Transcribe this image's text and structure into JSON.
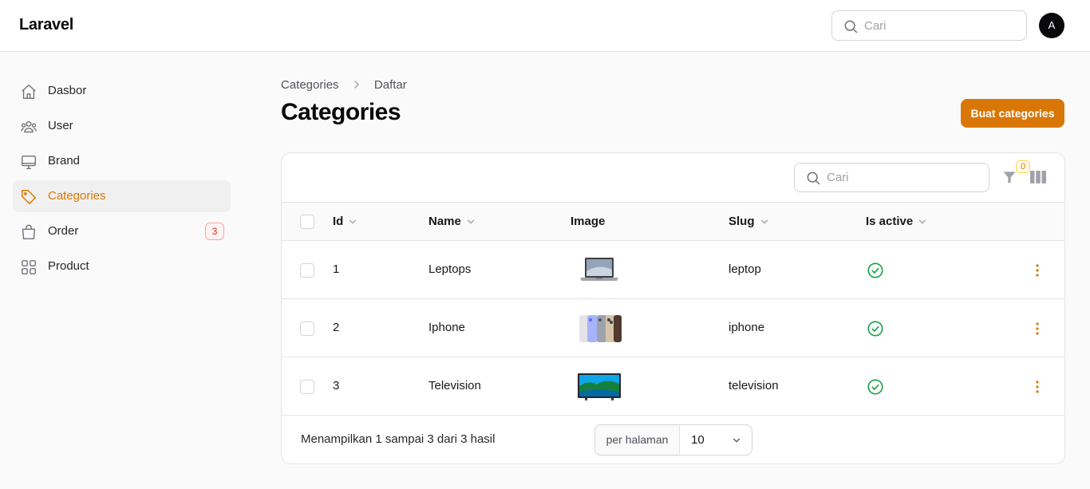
{
  "app": {
    "brand": "Laravel",
    "avatar_initial": "A",
    "search_placeholder": "Cari"
  },
  "sidebar": {
    "items": [
      {
        "label": "Dasbor",
        "icon": "home-icon",
        "active": false
      },
      {
        "label": "User",
        "icon": "users-icon",
        "active": false
      },
      {
        "label": "Brand",
        "icon": "monitor-icon",
        "active": false
      },
      {
        "label": "Categories",
        "icon": "tag-icon",
        "active": true
      },
      {
        "label": "Order",
        "icon": "shopping-bag-icon",
        "active": false,
        "badge": "3"
      },
      {
        "label": "Product",
        "icon": "grid-icon",
        "active": false
      }
    ]
  },
  "breadcrumb": {
    "parent": "Categories",
    "current": "Daftar"
  },
  "page": {
    "title": "Categories",
    "create_label": "Buat categories"
  },
  "table": {
    "search_placeholder": "Cari",
    "filter_count": "0",
    "columns": {
      "id": "Id",
      "name": "Name",
      "image": "Image",
      "slug": "Slug",
      "is_active": "Is active"
    },
    "rows": [
      {
        "id": "1",
        "name": "Leptops",
        "image": "laptop",
        "slug": "leptop",
        "is_active": true
      },
      {
        "id": "2",
        "name": "Iphone",
        "image": "phones",
        "slug": "iphone",
        "is_active": true
      },
      {
        "id": "3",
        "name": "Television",
        "image": "television",
        "slug": "television",
        "is_active": true
      }
    ],
    "summary": "Menampilkan 1 sampai 3 dari 3 hasil",
    "per_page_label": "per halaman",
    "per_page_value": "10"
  },
  "colors": {
    "accent": "#d97706",
    "success": "#16a34a",
    "danger": "#dc2626"
  }
}
